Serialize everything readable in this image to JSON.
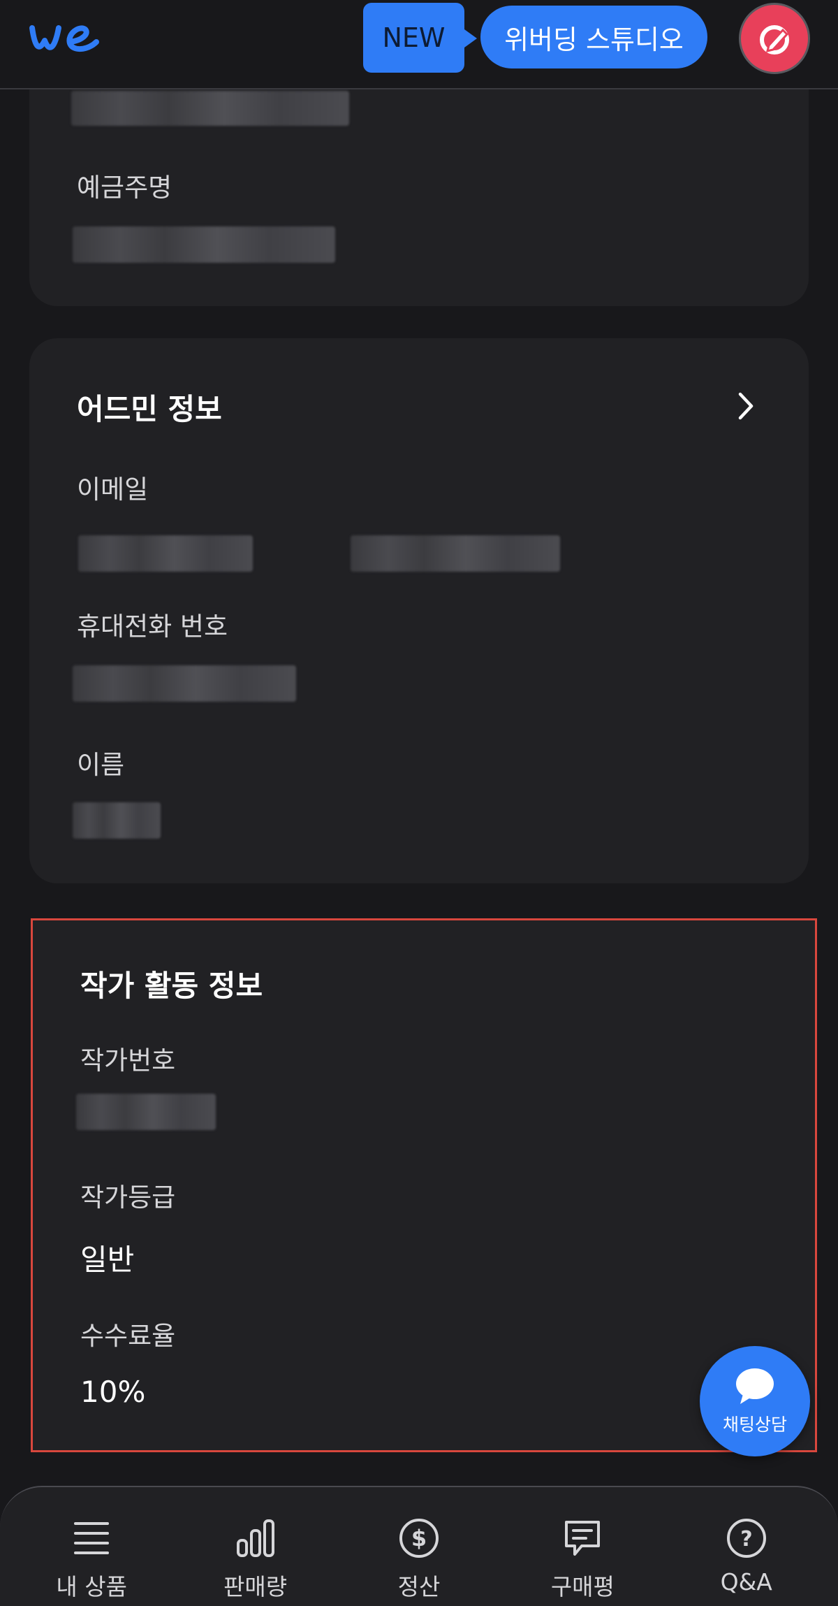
{
  "header": {
    "new_badge": "NEW",
    "studio_button": "위버딩 스튜디오",
    "accent_color": "#2f7cf6",
    "edit_color": "#e8405a"
  },
  "account_card": {
    "holder_label": "예금주명"
  },
  "admin_card": {
    "title": "어드민 정보",
    "email_label": "이메일",
    "phone_label": "휴대전화 번호",
    "name_label": "이름"
  },
  "artist_card": {
    "title": "작가 활동 정보",
    "number_label": "작가번호",
    "grade_label": "작가등급",
    "grade_value": "일반",
    "fee_label": "수수료율",
    "fee_value": "10%",
    "highlight_color": "#d8473d"
  },
  "chat": {
    "label": "채팅상담"
  },
  "bottom_nav": {
    "items": [
      {
        "label": "내 상품",
        "icon": "list-icon"
      },
      {
        "label": "판매량",
        "icon": "bar-chart-icon"
      },
      {
        "label": "정산",
        "icon": "dollar-icon"
      },
      {
        "label": "구매평",
        "icon": "review-icon"
      },
      {
        "label": "Q&A",
        "icon": "question-icon"
      }
    ]
  }
}
